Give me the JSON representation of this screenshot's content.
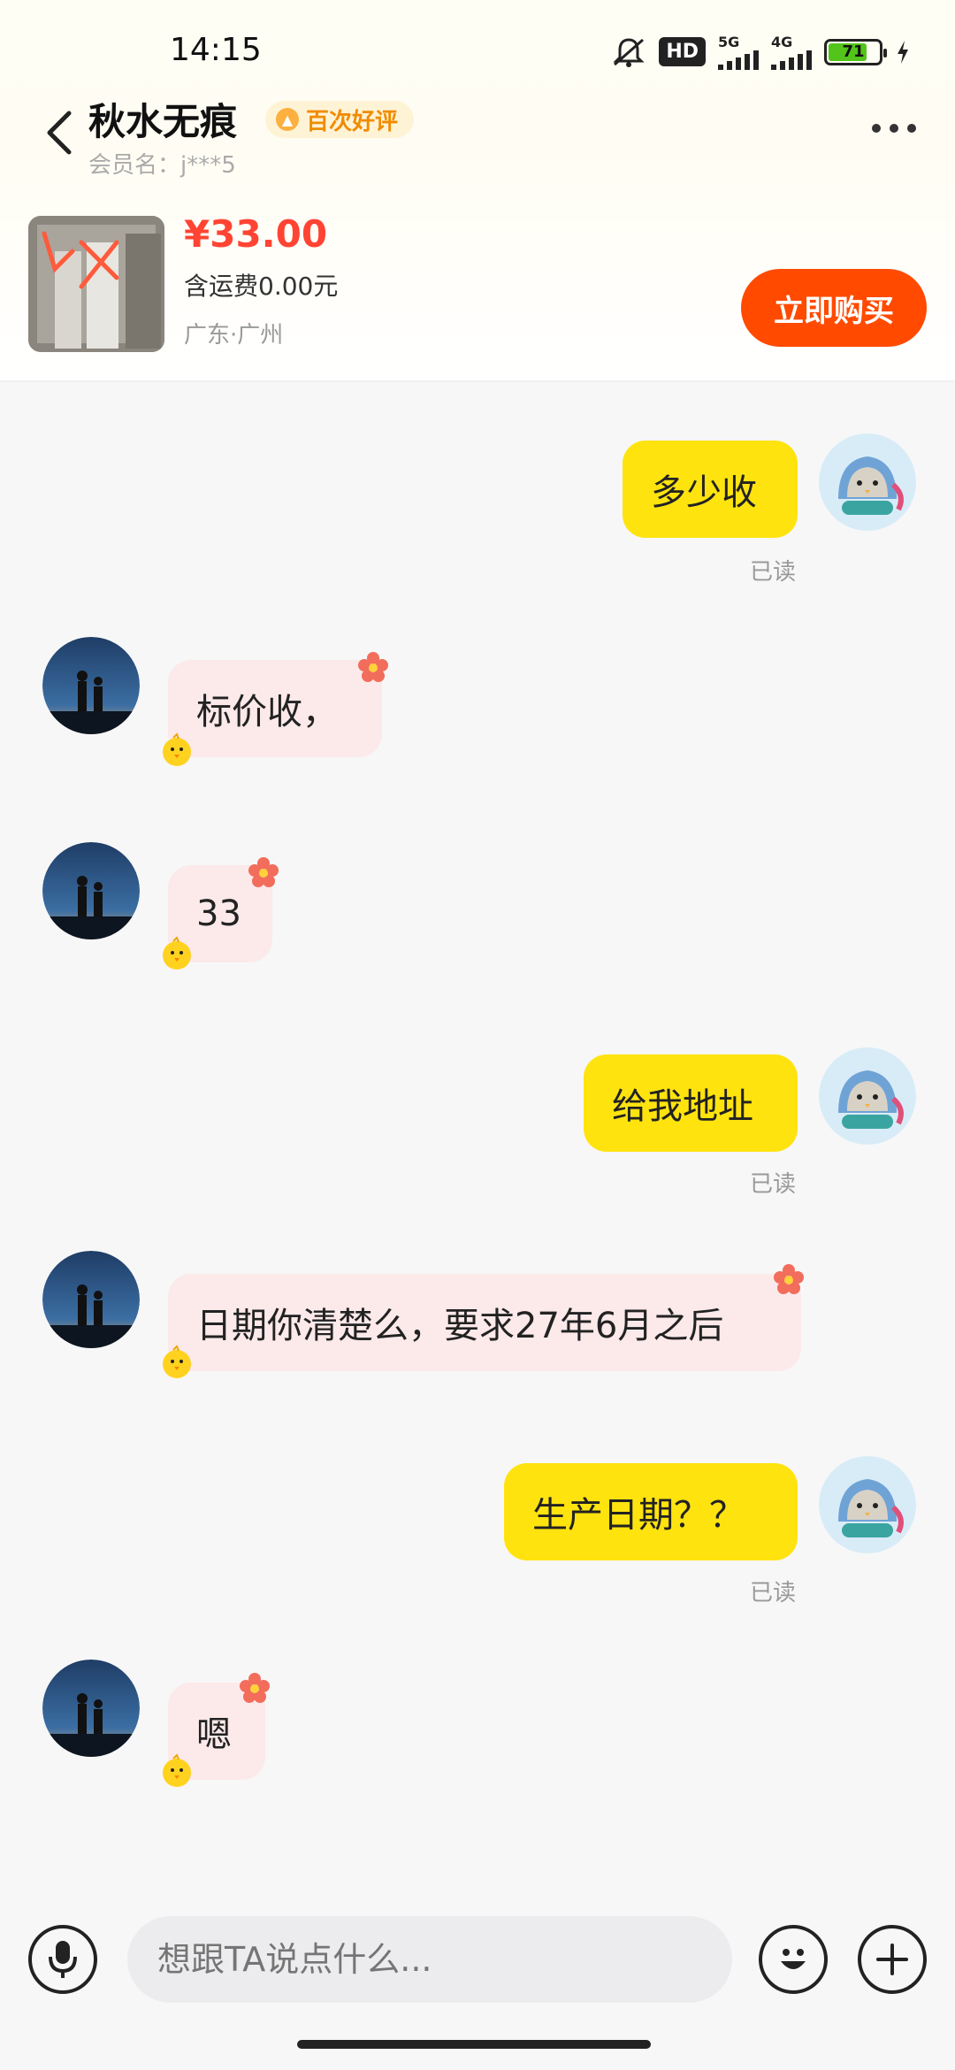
{
  "status_bar": {
    "time": "14:15",
    "hd_label": "HD",
    "net_5g": "5G",
    "net_4g": "4G",
    "battery": "71"
  },
  "header": {
    "shop_name": "秋水无痕",
    "badge": "百次好评",
    "member": "会员名：j***5"
  },
  "product": {
    "price": "¥33.00",
    "shipping": "含运费0.00元",
    "location": "广东·广州",
    "buy_label": "立即购买"
  },
  "messages": [
    {
      "side": "me",
      "text": "多少收",
      "status": "已读"
    },
    {
      "side": "them",
      "text": "标价收，"
    },
    {
      "side": "them",
      "text": "33"
    },
    {
      "side": "me",
      "text": "给我地址",
      "status": "已读"
    },
    {
      "side": "them",
      "text": "日期你清楚么，要求27年6月之后"
    },
    {
      "side": "me",
      "text": "生产日期？？",
      "status": "已读"
    },
    {
      "side": "them",
      "text": "嗯"
    }
  ],
  "composer": {
    "placeholder": "想跟TA说点什么..."
  },
  "icons": {
    "back": "back-arrow-icon",
    "more": "more-icon",
    "voice": "microphone-icon",
    "emoji": "emoji-icon",
    "add": "plus-icon"
  },
  "colors": {
    "my_bubble": "#ffe30f",
    "their_bubble": "#fce9ea",
    "buy_button": "#ff4a00",
    "price": "#ff4433"
  }
}
